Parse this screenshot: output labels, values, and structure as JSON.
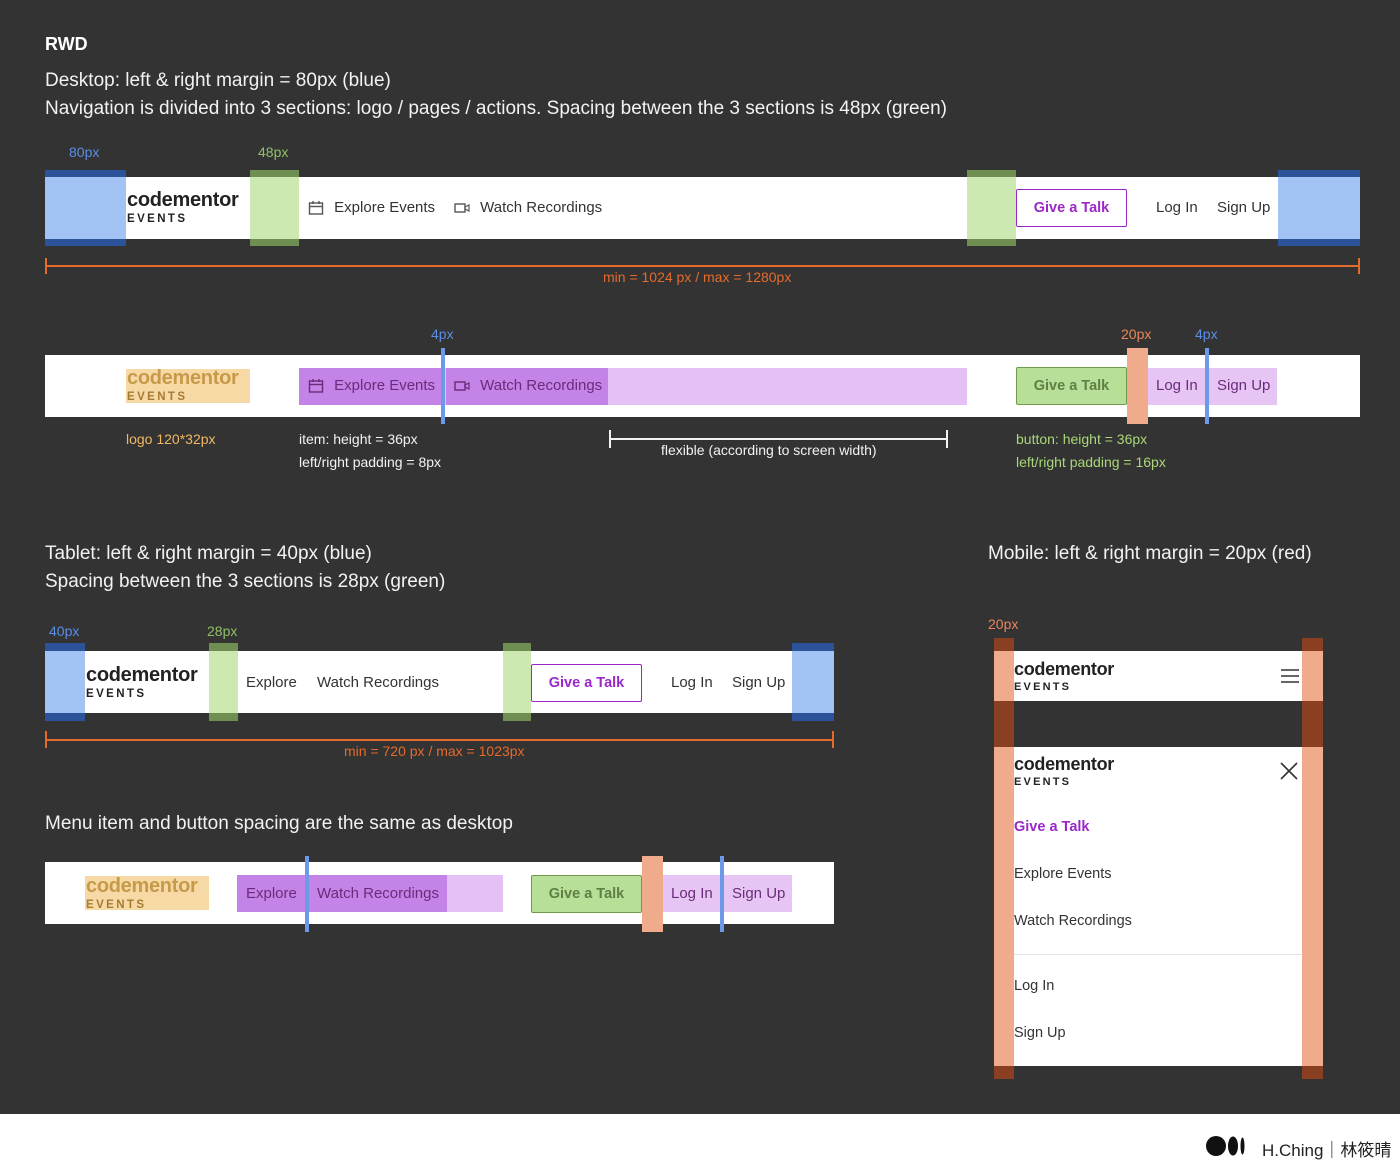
{
  "header": {
    "title": "RWD",
    "desktop_line1": "Desktop: left & right margin = 80px (blue)",
    "desktop_line2": "Navigation is divided into 3 sections: logo / pages / actions. Spacing between the 3 sections is 48px (green)",
    "tablet_line1": "Tablet: left & right margin = 40px (blue)",
    "tablet_line2": "Spacing between the 3 sections is 28px (green)",
    "mobile_line1": "Mobile: left & right margin = 20px (red)",
    "tablet_note": "Menu item and button spacing are the same as desktop"
  },
  "logo": {
    "name": "codementor",
    "sub": "EVENTS"
  },
  "nav": {
    "explore_events": "Explore Events",
    "explore": "Explore",
    "watch_recordings": "Watch Recordings",
    "give_talk": "Give a Talk",
    "log_in": "Log In",
    "sign_up": "Sign Up"
  },
  "annotations": {
    "d_80": "80px",
    "d_48": "48px",
    "d_range": "min = 1024 px / max = 1280px",
    "d_4a": "4px",
    "d_20": "20px",
    "d_4b": "4px",
    "logo_size": "logo 120*32px",
    "item_h": "item: height = 36px",
    "item_pad": "left/right padding = 8px",
    "flexible": "flexible (according to screen width)",
    "btn_h": "button: height = 36px",
    "btn_pad": "left/right padding = 16px",
    "t_40": "40px",
    "t_28": "28px",
    "t_range": "min = 720 px / max = 1023px",
    "m_20": "20px"
  },
  "footer": {
    "author": "H.Ching｜林筱晴"
  },
  "colors": {
    "blue": "#5b8ee6",
    "green": "#8fc068",
    "orange": "#e36b2c",
    "purple": "#9b27c9",
    "background": "#333333"
  }
}
